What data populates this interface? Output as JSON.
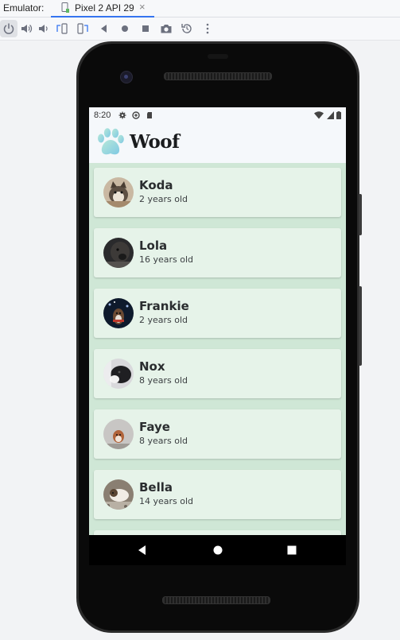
{
  "emulator": {
    "label": "Emulator:",
    "tab_label": "Pixel 2 API 29",
    "tab_close": "×",
    "accent_color": "#3574f0"
  },
  "toolbar": {
    "buttons": [
      {
        "icon": "power-icon"
      },
      {
        "icon": "volume-up-icon"
      },
      {
        "icon": "volume-down-icon"
      },
      {
        "icon": "rotate-left-icon"
      },
      {
        "icon": "rotate-right-icon"
      },
      {
        "icon": "back-icon"
      },
      {
        "icon": "home-icon"
      },
      {
        "icon": "overview-icon"
      },
      {
        "icon": "camera-icon"
      },
      {
        "icon": "snapshot-icon"
      },
      {
        "icon": "more-icon"
      }
    ]
  },
  "status_bar": {
    "time": "8:20",
    "icons": [
      "gear-icon",
      "data-saver-icon",
      "sd-card-icon",
      "wifi-icon",
      "battery-icon"
    ]
  },
  "app": {
    "title": "Woof",
    "logo_icon": "paw-icon",
    "colors": {
      "background": "#cfe7d6",
      "card": "#e6f3e9",
      "app_bar": "#f5f8fb"
    }
  },
  "dogs": [
    {
      "name": "Koda",
      "age": "2 years old"
    },
    {
      "name": "Lola",
      "age": "16 years old"
    },
    {
      "name": "Frankie",
      "age": "2 years old"
    },
    {
      "name": "Nox",
      "age": "8 years old"
    },
    {
      "name": "Faye",
      "age": "8 years old"
    },
    {
      "name": "Bella",
      "age": "14 years old"
    }
  ],
  "nav_bar": {
    "buttons": [
      "back-triangle-icon",
      "home-circle-icon",
      "recents-square-icon"
    ]
  }
}
